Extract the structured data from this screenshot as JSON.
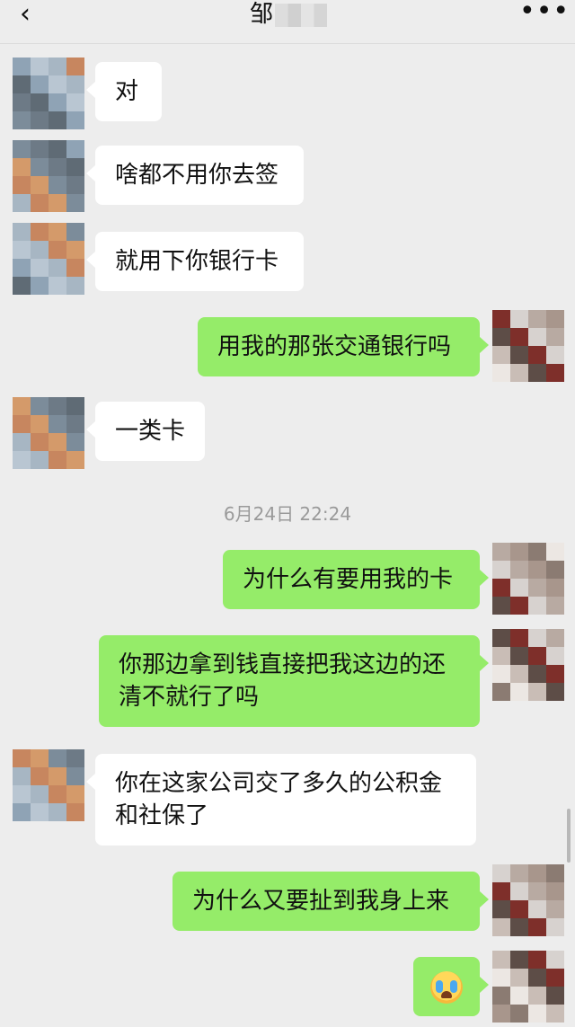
{
  "header": {
    "back_glyph": "‹",
    "title": "邹",
    "more_glyph": "•••"
  },
  "timestamp": "6月24日 22:24",
  "messages": [
    {
      "side": "left",
      "text": "对"
    },
    {
      "side": "left",
      "text": "啥都不用你去签"
    },
    {
      "side": "left",
      "text": "就用下你银行卡"
    },
    {
      "side": "right",
      "text": "用我的那张交通银行吗"
    },
    {
      "side": "left",
      "text": "一类卡"
    },
    {
      "side": "right",
      "text": "为什么有要用我的卡"
    },
    {
      "side": "right",
      "text": "你那边拿到钱直接把我这边的还清不就行了吗"
    },
    {
      "side": "left",
      "text": "你在这家公司交了多久的公积金和社保了"
    },
    {
      "side": "right",
      "text": "为什么又要扯到我身上来"
    },
    {
      "side": "right",
      "emoji": "loudly-crying-face"
    }
  ],
  "colors": {
    "background": "#ededed",
    "bubble_self": "#95ec69",
    "bubble_other": "#ffffff"
  }
}
